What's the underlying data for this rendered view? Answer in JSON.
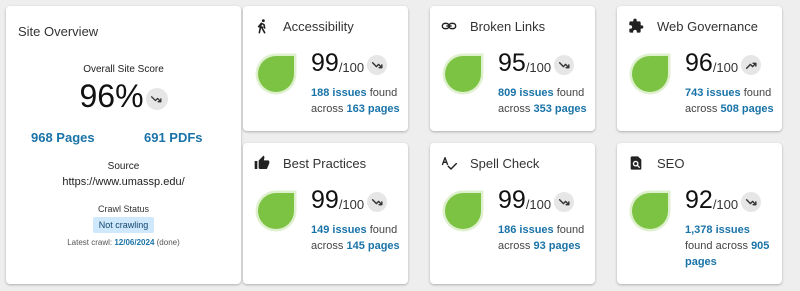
{
  "overview": {
    "title": "Site Overview",
    "score_label": "Overall Site Score",
    "score": "96%",
    "score_trend": "down",
    "pages": "968 Pages",
    "pdfs": "691 PDFs",
    "source_label": "Source",
    "source_url": "https://www.umassp.edu/",
    "crawl_label": "Crawl Status",
    "crawl_status": "Not crawling",
    "latest_prefix": "Latest crawl:",
    "latest_date": "12/06/2024",
    "latest_suffix": "(done)"
  },
  "metrics": [
    {
      "title": "Accessibility",
      "icon": "accessibility-icon",
      "score": "99",
      "max": "/100",
      "trend": "down",
      "issues": "188 issues",
      "found": "found",
      "across": "across",
      "pages": "163 pages"
    },
    {
      "title": "Broken Links",
      "icon": "link-icon",
      "score": "95",
      "max": "/100",
      "trend": "down",
      "issues": "809 issues",
      "found": "found",
      "across": "across",
      "pages": "353 pages"
    },
    {
      "title": "Web Governance",
      "icon": "puzzle-icon",
      "score": "96",
      "max": "/100",
      "trend": "up",
      "issues": "743 issues",
      "found": "found",
      "across": "across",
      "pages": "508 pages"
    },
    {
      "title": "Best Practices",
      "icon": "thumbs-up-icon",
      "score": "99",
      "max": "/100",
      "trend": "down",
      "issues": "149 issues",
      "found": "found",
      "across": "across",
      "pages": "145 pages"
    },
    {
      "title": "Spell Check",
      "icon": "spellcheck-icon",
      "score": "99",
      "max": "/100",
      "trend": "down",
      "issues": "186 issues",
      "found": "found",
      "across": "across",
      "pages": "93 pages"
    },
    {
      "title": "SEO",
      "icon": "seo-icon",
      "score": "92",
      "max": "/100",
      "trend": "down",
      "issues": "1,378 issues",
      "found": "found",
      "across": "across",
      "pages": "905 pages"
    }
  ],
  "colors": {
    "link": "#1a73a8",
    "score_blob": "#7cc243",
    "score_ring": "#dff0cf"
  }
}
